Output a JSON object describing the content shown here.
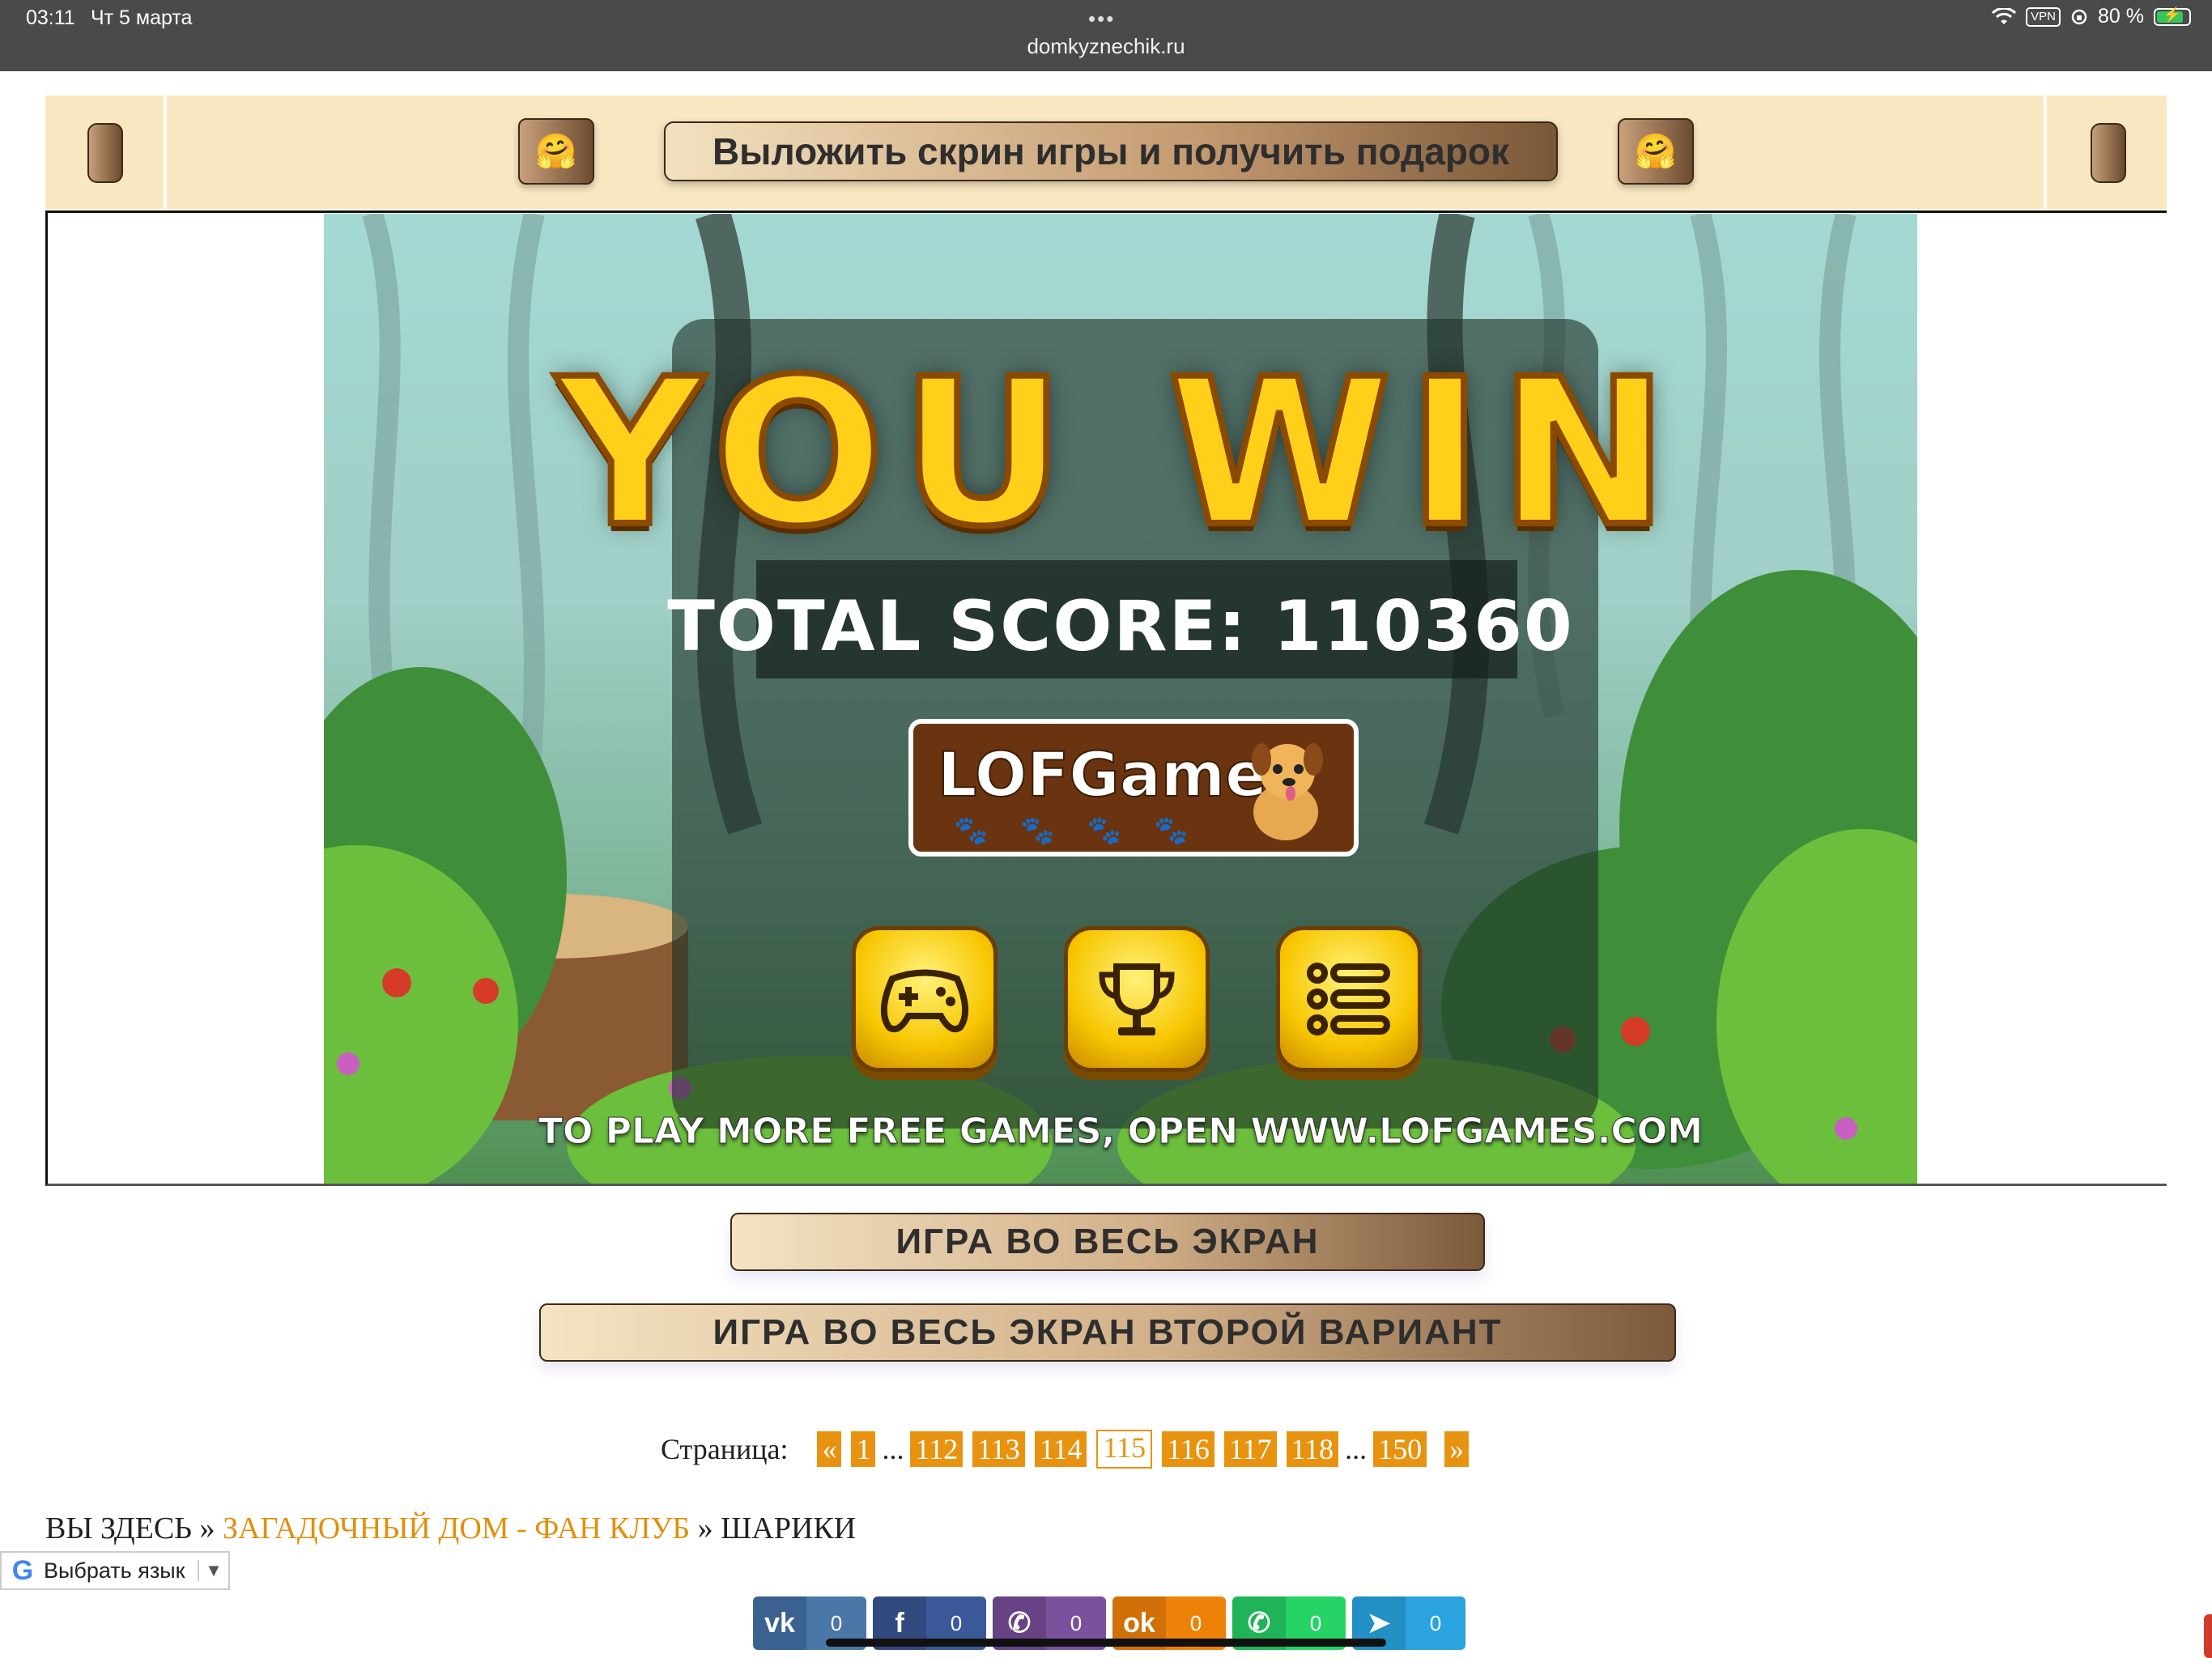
{
  "status_bar": {
    "time": "03:11",
    "date": "Чт 5 марта",
    "dots": "•••",
    "url": "domkyznechik.ru",
    "vpn": "VPN",
    "battery": "80 %"
  },
  "banner": {
    "title": "Выложить скрин игры и получить подарок",
    "emoji": "🤗"
  },
  "game": {
    "headline": "YOU WIN",
    "score_text": "TOTAL SCORE: 110360",
    "logo_text": "LOFGames",
    "paws": "🐾🐾🐾🐾",
    "footer": "TO PLAY MORE FREE GAMES, OPEN WWW.LOFGAMES.COM",
    "buttons": [
      "gamepad-icon",
      "trophy-icon",
      "menu-list-icon"
    ]
  },
  "fullscreen": {
    "primary": "ИГРА ВО ВЕСЬ ЭКРАН",
    "secondary": "ИГРА ВО ВЕСЬ ЭКРАН ВТОРОЙ ВАРИАНТ"
  },
  "pagination": {
    "label": "Страница:",
    "prev": "«",
    "next": "»",
    "ellipsis": "...",
    "pages": [
      "1",
      "112",
      "113",
      "114",
      "115",
      "116",
      "117",
      "118",
      "150"
    ],
    "current": "115"
  },
  "breadcrumb": {
    "prefix": "ВЫ ЗДЕСЬ",
    "sep": "»",
    "link": "ЗАГАДОЧНЫЙ ДОМ - ФАН КЛУБ",
    "current": "ШАРИКИ"
  },
  "translate": {
    "logo": "G",
    "label": "Выбрать язык",
    "arrow": "▼"
  },
  "share": [
    {
      "icon": "vk-icon",
      "glyph": "vk",
      "count": "0",
      "color": "#4a76a8",
      "dark": "#3b6190"
    },
    {
      "icon": "facebook-icon",
      "glyph": "f",
      "count": "0",
      "color": "#3b5998",
      "dark": "#304a80"
    },
    {
      "icon": "viber-icon",
      "glyph": "✆",
      "count": "0",
      "color": "#7b519d",
      "dark": "#674385"
    },
    {
      "icon": "odnoklassniki-icon",
      "glyph": "ok",
      "count": "0",
      "color": "#ee8208",
      "dark": "#d07006"
    },
    {
      "icon": "whatsapp-icon",
      "glyph": "✆",
      "count": "0",
      "color": "#25d366",
      "dark": "#1fb457"
    },
    {
      "icon": "telegram-icon",
      "glyph": "➤",
      "count": "0",
      "color": "#2aa3de",
      "dark": "#2290c4"
    }
  ]
}
